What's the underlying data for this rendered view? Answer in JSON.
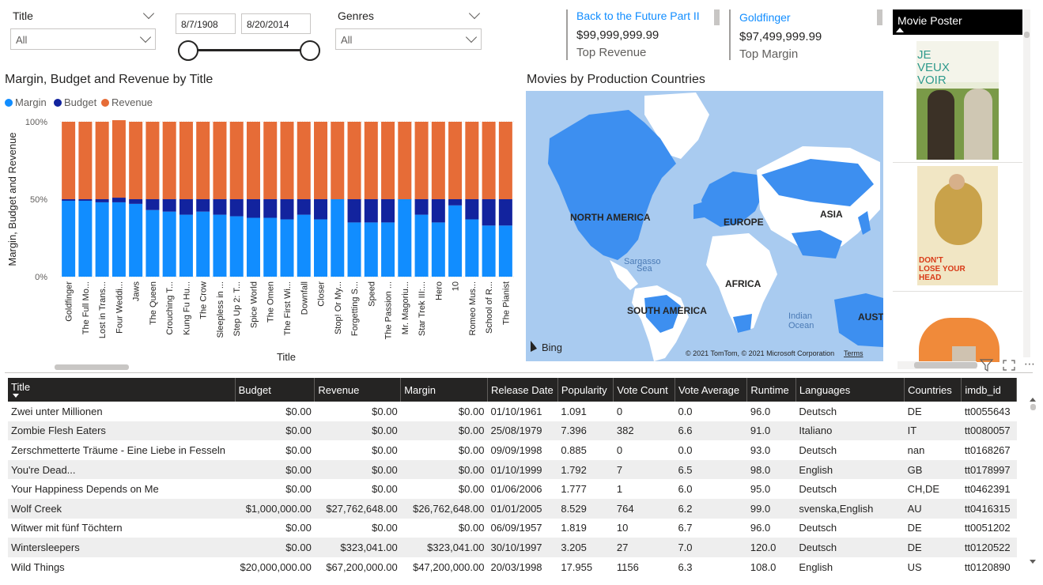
{
  "slicers": {
    "title": {
      "label": "Title",
      "value": "All"
    },
    "date": {
      "start": "8/7/1908",
      "end": "8/20/2014"
    },
    "genres": {
      "label": "Genres",
      "value": "All"
    }
  },
  "kpis": [
    {
      "title": "Back to the Future Part II",
      "value": "$99,999,999.99",
      "label": "Top Revenue"
    },
    {
      "title": "Goldfinger",
      "value": "$97,499,999.99",
      "label": "Top Margin"
    }
  ],
  "poster_panel": {
    "header": "Movie Poster",
    "poster1_text": [
      "JE",
      "VEUX",
      "VOIR"
    ],
    "poster2_text": [
      "DON'T",
      "LOSE YOUR",
      "HEAD"
    ]
  },
  "bar_chart": {
    "title": "Margin, Budget and Revenue by Title",
    "x_axis_title": "Title",
    "y_axis_title": "Margin, Budget and Revenue"
  },
  "chart_data": {
    "type": "bar",
    "stacked": "100%",
    "title": "Margin, Budget and Revenue by Title",
    "xlabel": "Title",
    "ylabel": "Margin, Budget and Revenue",
    "yticks": [
      "100%",
      "50%",
      "0%"
    ],
    "legend": "top-left",
    "categories": [
      "Goldfinger",
      "The Full Mo...",
      "Lost in Trans...",
      "Four Weddi...",
      "Jaws",
      "The Queen",
      "Crouching T...",
      "Kung Fu Hu...",
      "The Crow",
      "Sleepless in ...",
      "Step Up 2: T...",
      "Spice World",
      "The Omen",
      "The First Wi...",
      "Downfall",
      "Closer",
      "Stop! Or My...",
      "Forgetting S...",
      "Speed",
      "The Passion ...",
      "Mr. Magoriu...",
      "Star Trek III:...",
      "Hero",
      "10",
      "Romeo Mus...",
      "School of R...",
      "The Pianist"
    ],
    "series": [
      {
        "name": "Margin",
        "color": "#118dff",
        "values": [
          49,
          49,
          48,
          48,
          47,
          43,
          42,
          40,
          42,
          40,
          39,
          38,
          38,
          37,
          40,
          37,
          50,
          35,
          35,
          35,
          50,
          40,
          35,
          46,
          37,
          33,
          33
        ]
      },
      {
        "name": "Budget",
        "color": "#12239e",
        "values": [
          1,
          1,
          2,
          3,
          3,
          7,
          8,
          10,
          8,
          10,
          11,
          12,
          12,
          13,
          10,
          13,
          0,
          15,
          15,
          15,
          0,
          10,
          15,
          4,
          13,
          17,
          17
        ]
      },
      {
        "name": "Revenue",
        "color": "#e66c37",
        "values": [
          50,
          50,
          50,
          50,
          50,
          50,
          50,
          50,
          50,
          50,
          50,
          50,
          50,
          50,
          50,
          50,
          50,
          50,
          50,
          50,
          50,
          50,
          50,
          50,
          50,
          50,
          50
        ]
      }
    ]
  },
  "map": {
    "title": "Movies by Production Countries",
    "labels": {
      "na": "NORTH AMERICA",
      "eu": "EUROPE",
      "asia": "ASIA",
      "africa": "AFRICA",
      "sa": "SOUTH AMERICA",
      "aus": "AUSTR",
      "sargasso": [
        "Sargasso",
        "Sea"
      ],
      "indian": [
        "Indian",
        "Ocean"
      ]
    },
    "bing": "Bing",
    "copyright": "© 2021 TomTom, © 2021 Microsoft Corporation",
    "terms": "Terms"
  },
  "table": {
    "columns": [
      "Title",
      "Budget",
      "Revenue",
      "Margin",
      "Release Date",
      "Popularity",
      "Vote Count",
      "Vote Average",
      "Runtime",
      "Languages",
      "Countries",
      "imdb_id"
    ],
    "rows": [
      [
        "Zwei unter Millionen",
        "$0.00",
        "$0.00",
        "$0.00",
        "01/10/1961",
        "1.091",
        "0",
        "0.0",
        "96.0",
        "Deutsch",
        "DE",
        "tt0055643"
      ],
      [
        "Zombie Flesh Eaters",
        "$0.00",
        "$0.00",
        "$0.00",
        "25/08/1979",
        "7.396",
        "382",
        "6.6",
        "91.0",
        "Italiano",
        "IT",
        "tt0080057"
      ],
      [
        "Zerschmetterte Träume - Eine Liebe in Fesseln",
        "$0.00",
        "$0.00",
        "$0.00",
        "09/09/1998",
        "0.885",
        "0",
        "0.0",
        "93.0",
        "Deutsch",
        "nan",
        "tt0168267"
      ],
      [
        "You're Dead...",
        "$0.00",
        "$0.00",
        "$0.00",
        "01/10/1999",
        "1.792",
        "7",
        "6.5",
        "98.0",
        "English",
        "GB",
        "tt0178997"
      ],
      [
        "Your Happiness Depends on Me",
        "$0.00",
        "$0.00",
        "$0.00",
        "01/06/2006",
        "1.777",
        "1",
        "6.0",
        "95.0",
        "Deutsch",
        "CH,DE",
        "tt0462391"
      ],
      [
        "Wolf Creek",
        "$1,000,000.00",
        "$27,762,648.00",
        "$26,762,648.00",
        "01/01/2005",
        "8.529",
        "764",
        "6.2",
        "99.0",
        "svenska,English",
        "AU",
        "tt0416315"
      ],
      [
        "Witwer mit fünf Töchtern",
        "$0.00",
        "$0.00",
        "$0.00",
        "06/09/1957",
        "1.819",
        "10",
        "6.7",
        "96.0",
        "Deutsch",
        "DE",
        "tt0051202"
      ],
      [
        "Wintersleepers",
        "$0.00",
        "$323,041.00",
        "$323,041.00",
        "30/10/1997",
        "3.205",
        "27",
        "7.0",
        "120.0",
        "Deutsch",
        "DE",
        "tt0120522"
      ],
      [
        "Wild Things",
        "$20,000,000.00",
        "$67,200,000.00",
        "$47,200,000.00",
        "20/03/1998",
        "17.955",
        "1156",
        "6.3",
        "108.0",
        "English",
        "US",
        "tt0120890"
      ]
    ]
  }
}
